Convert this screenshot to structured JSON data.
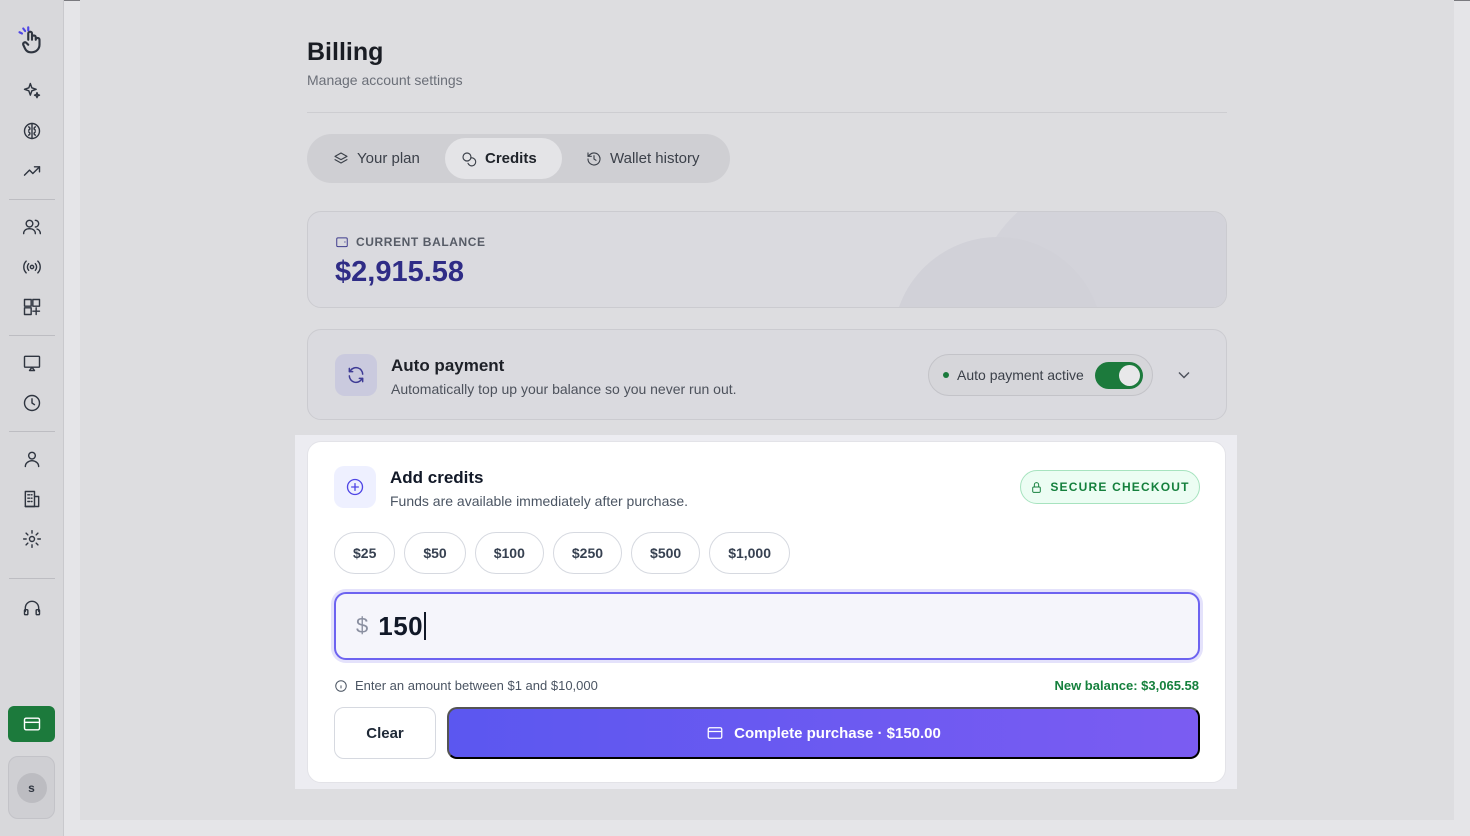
{
  "page": {
    "title": "Billing",
    "subtitle": "Manage account settings"
  },
  "tabs": [
    {
      "label": "Your plan",
      "icon": "layers-icon",
      "active": false
    },
    {
      "label": "Credits",
      "icon": "coins-icon",
      "active": true
    },
    {
      "label": "Wallet history",
      "icon": "history-icon",
      "active": false
    }
  ],
  "balance": {
    "label": "CURRENT BALANCE",
    "value": "$2,915.58"
  },
  "auto_payment": {
    "title": "Auto payment",
    "description": "Automatically top up your balance so you never run out.",
    "status": "Auto payment active",
    "enabled": true
  },
  "add_credits": {
    "title": "Add credits",
    "description": "Funds are available immediately after purchase.",
    "secure_badge": "SECURE CHECKOUT",
    "presets": [
      "$25",
      "$50",
      "$100",
      "$250",
      "$500",
      "$1,000"
    ],
    "currency_symbol": "$",
    "amount": "150",
    "hint": "Enter an amount between $1 and $10,000",
    "new_balance": "New balance: $3,065.58",
    "clear_label": "Clear",
    "purchase_label": "Complete purchase · $150.00"
  },
  "sidebar": {
    "avatar_initial": "s",
    "icons": [
      "logo-hand-icon",
      "sparkles-icon",
      "brain-icon",
      "trending-up-icon",
      "users-icon",
      "broadcast-icon",
      "grid-plus-icon",
      "screen-icon",
      "clock-icon",
      "user-icon",
      "building-icon",
      "gear-icon",
      "headset-icon",
      "credit-card-icon"
    ]
  },
  "colors": {
    "accent": "#5b57f0",
    "success": "#15803d",
    "balance_text": "#2f2c86"
  }
}
